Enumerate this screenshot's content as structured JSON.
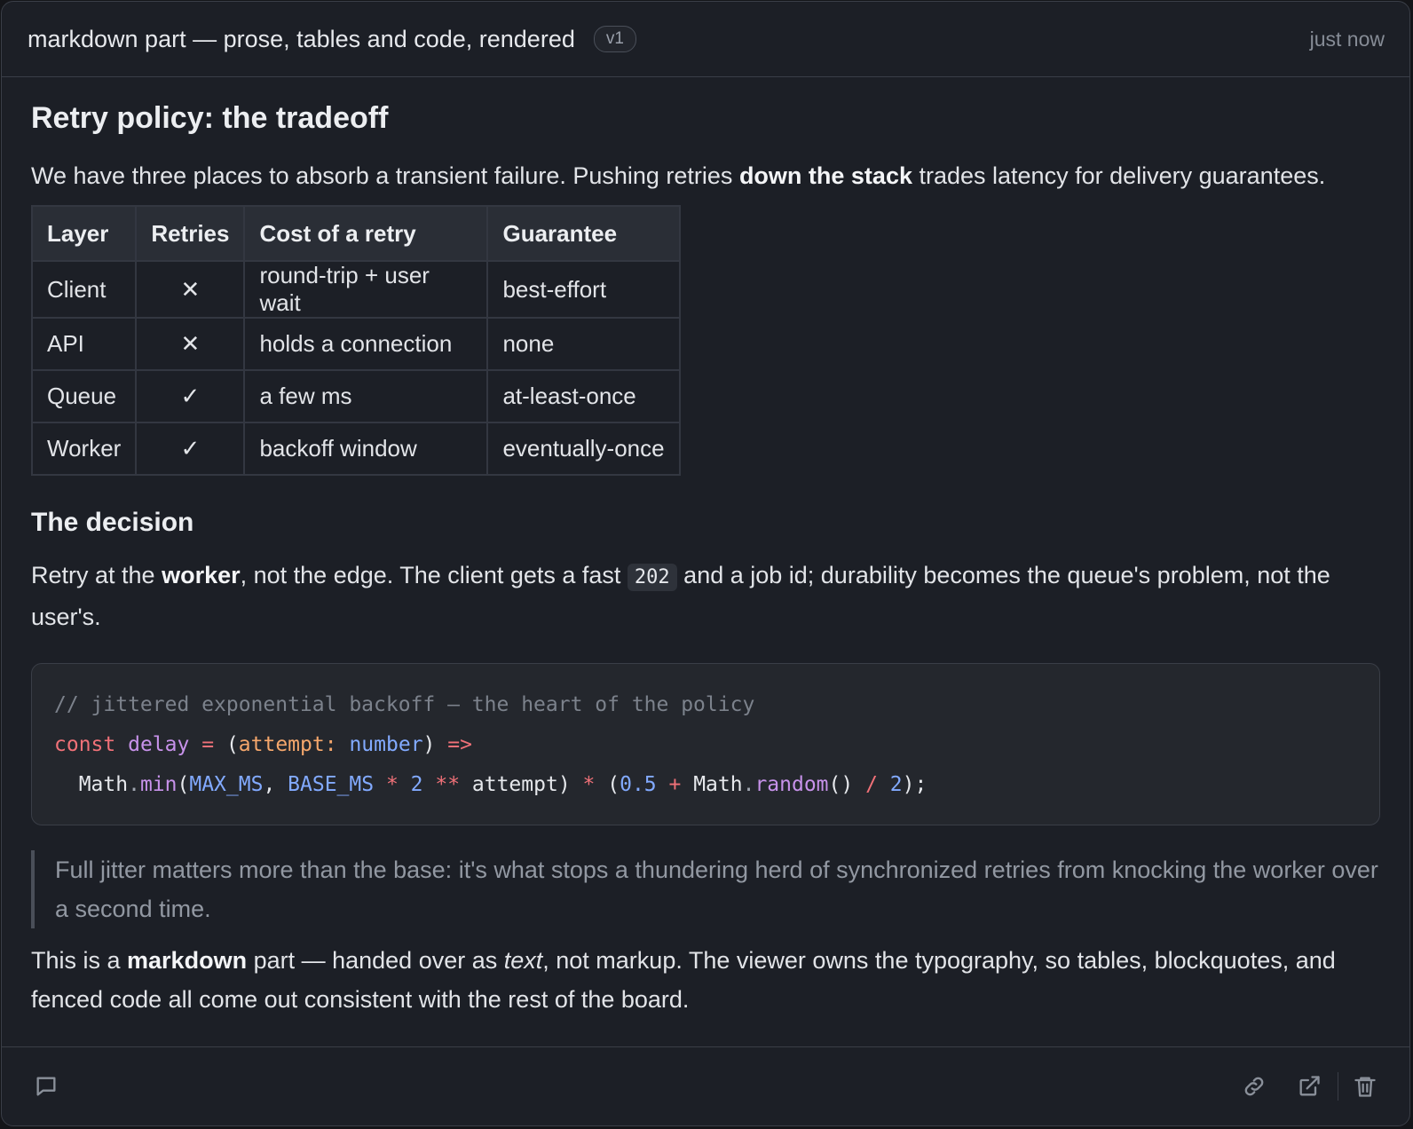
{
  "header": {
    "title": "markdown part — prose, tables and code, rendered",
    "version": "v1",
    "timestamp": "just now"
  },
  "doc": {
    "heading": "Retry policy: the tradeoff",
    "intro": {
      "before": "We have three places to absorb a transient failure. Pushing retries ",
      "bold": "down the stack",
      "after": " trades latency for delivery guarantees."
    },
    "table": {
      "headers": [
        "Layer",
        "Retries",
        "Cost of a retry",
        "Guarantee"
      ],
      "rows": [
        [
          "Client",
          "✕",
          "round-trip + user wait",
          "best-effort"
        ],
        [
          "API",
          "✕",
          "holds a connection",
          "none"
        ],
        [
          "Queue",
          "✓",
          "a few ms",
          "at-least-once"
        ],
        [
          "Worker",
          "✓",
          "backoff window",
          "eventually-once"
        ]
      ]
    },
    "subheading": "The decision",
    "decision": {
      "p1": "Retry at the ",
      "bold": "worker",
      "p2": ", not the edge. The client gets a fast ",
      "code": "202",
      "p3": " and a job id; durability becomes the queue's problem, not the user's."
    },
    "code": {
      "comment": "// jittered exponential backoff — the heart of the policy",
      "kw_const": "const",
      "fn_name": "delay",
      "eq": "=",
      "open": "(",
      "param": "attempt",
      "colon": ":",
      "type": "number",
      "close": ")",
      "arrow": "=>",
      "l3_indent": "  ",
      "l3_math": "Math",
      "l3_dot1": ".",
      "l3_min": "min",
      "l3_p1": "(",
      "l3_max": "MAX_MS",
      "l3_comma": ", ",
      "l3_base": "BASE_MS",
      "l3_star": " * ",
      "l3_two": "2",
      "l3_pow": " ** ",
      "l3_attempt": "attempt",
      "l3_p2": ") ",
      "l3_star2": "*",
      "l3_p3": " (",
      "l3_half": "0.5",
      "l3_plus": " + ",
      "l3_math2": "Math",
      "l3_dot2": ".",
      "l3_random": "random",
      "l3_call": "() ",
      "l3_div": "/",
      "l3_sp": " ",
      "l3_two2": "2",
      "l3_end": ");"
    },
    "quote": "Full jitter matters more than the base: it's what stops a thundering herd of synchronized retries from knocking the worker over a second time.",
    "outro": {
      "a": "This is a ",
      "bold": "markdown",
      "b": " part — handed over as ",
      "italic": "text",
      "c": ", not markup. The viewer owns the typography, so tables, blockquotes, and fenced code all come out consistent with the rest of the board."
    }
  },
  "footer": {
    "icons": [
      "comment-icon",
      "link-icon",
      "external-link-icon",
      "trash-icon"
    ]
  }
}
